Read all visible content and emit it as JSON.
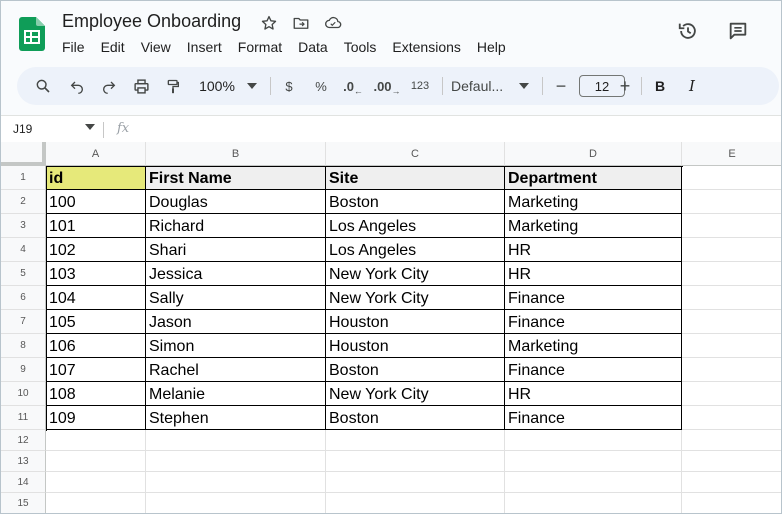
{
  "app": {
    "title": "Employee Onboarding",
    "menu": [
      "File",
      "Edit",
      "View",
      "Insert",
      "Format",
      "Data",
      "Tools",
      "Extensions",
      "Help"
    ],
    "icons": {
      "logo": "sheets-logo-icon",
      "star": "star-icon",
      "move": "folder-move-icon",
      "cloud": "cloud-status-icon",
      "history": "history-icon",
      "comments": "comment-icon"
    }
  },
  "toolbar": {
    "zoom": "100%",
    "currency": "$",
    "percent": "%",
    "decrease_decimal": ".0",
    "increase_decimal": ".00",
    "number_format": "123",
    "font": "Defaul...",
    "font_size": "12",
    "bold": "B",
    "italic": "I",
    "minus": "−",
    "plus": "+"
  },
  "formula_bar": {
    "name_box": "J19",
    "fx": "fx"
  },
  "sheet": {
    "columns": [
      "A",
      "B",
      "C",
      "D",
      "E"
    ],
    "row_numbers": [
      "1",
      "2",
      "3",
      "4",
      "5",
      "6",
      "7",
      "8",
      "9",
      "10",
      "11",
      "12",
      "13",
      "14",
      "15"
    ],
    "headers": [
      "id",
      "First Name",
      "Site",
      "Department"
    ],
    "rows": [
      [
        "100",
        "Douglas",
        "Boston",
        "Marketing"
      ],
      [
        "101",
        "Richard",
        "Los Angeles",
        "Marketing"
      ],
      [
        "102",
        "Shari",
        "Los Angeles",
        "HR"
      ],
      [
        "103",
        "Jessica",
        "New York City",
        "HR"
      ],
      [
        "104",
        "Sally",
        "New York City",
        "Finance"
      ],
      [
        "105",
        "Jason",
        "Houston",
        "Finance"
      ],
      [
        "106",
        "Simon",
        "Houston",
        "Marketing"
      ],
      [
        "107",
        "Rachel",
        "Boston",
        "Finance"
      ],
      [
        "108",
        "Melanie",
        "New York City",
        "HR"
      ],
      [
        "109",
        "Stephen",
        "Boston",
        "Finance"
      ]
    ]
  },
  "colors": {
    "id_header_fill": "#e6e97a",
    "header_fill": "#efefef",
    "logo_green": "#0f9d58",
    "toolbar_bg": "#edf2fa"
  }
}
